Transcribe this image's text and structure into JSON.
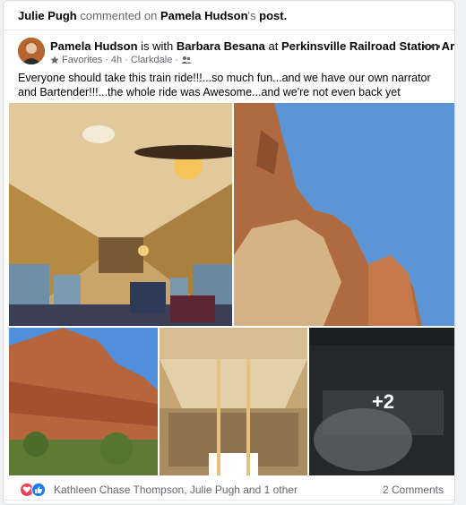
{
  "activity": {
    "actor": "Julie Pugh",
    "verb": "commented on",
    "target_owner": "Pamela Hudson",
    "target_suffix": "'s",
    "target_noun": "post."
  },
  "post": {
    "author": "Pamela Hudson",
    "with_text": "is with",
    "tagged": "Barbara Besana",
    "at_text": "at",
    "location": "Perkinsville Railroad Station Arizona",
    "location_end": ".",
    "favorites_label": "Favorites",
    "time": "4h",
    "place": "Clarkdale",
    "separator": "·",
    "more_icon": "more-horizontal-icon",
    "text": "Everyone should take this train ride!!!...so much fun...and we have our own narrator and Bartender!!!...the whole ride was Awesome...and we're not even back yet",
    "extra_photos": "+2"
  },
  "footer": {
    "reaction_names": "Kathleen Chase Thompson, Julie Pugh and 1 other",
    "comments": "2 Comments"
  },
  "colors": {
    "link_blue": "#1877f2",
    "love_red": "#f33e58",
    "secondary_text": "#65676b"
  }
}
